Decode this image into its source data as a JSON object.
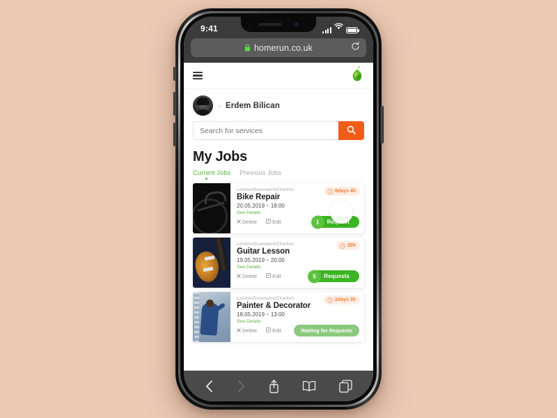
{
  "device": {
    "status_bar": {
      "time": "9:41",
      "signal_icon": "cellular-signal-icon",
      "wifi_icon": "wifi-icon",
      "battery_icon": "battery-icon"
    },
    "browser": {
      "lock_icon": "lock-icon",
      "url": "homerun.co.uk",
      "reload_icon": "reload-icon",
      "toolbar": [
        {
          "name": "back-button",
          "icon": "chevron-left-icon",
          "enabled": true
        },
        {
          "name": "forward-button",
          "icon": "chevron-right-icon",
          "enabled": false
        },
        {
          "name": "share-button",
          "icon": "share-icon",
          "enabled": true
        },
        {
          "name": "bookmarks-button",
          "icon": "book-icon",
          "enabled": true
        },
        {
          "name": "tabs-button",
          "icon": "tabs-icon",
          "enabled": true
        }
      ]
    }
  },
  "app": {
    "header": {
      "menu_icon": "hamburger-menu-icon",
      "logo_icon": "pear-logo-icon"
    },
    "profile": {
      "avatar_icon": "user-avatar",
      "separator": "·",
      "name": "Erdem Bilican"
    },
    "search": {
      "placeholder": "Search for services",
      "value": "",
      "button_icon": "search-icon"
    },
    "page_title": "My Jobs",
    "tabs": [
      {
        "label": "Current Jobs",
        "active": true
      },
      {
        "label": "Previous Jobs",
        "active": false
      }
    ],
    "jobs": [
      {
        "location": "London/Greenwich/Charlton",
        "title": "Bike Repair",
        "date": "20.05.2019",
        "separator": "•",
        "time": "18:00",
        "details_link": "See Details",
        "delete_label": "Delete",
        "delete_icon": "close-x-icon",
        "edit_label": "Edit",
        "edit_icon": "pencil-edit-icon",
        "time_badge": {
          "icon": "clock-icon",
          "text": "6days 4h"
        },
        "action": {
          "label": "Request",
          "count": "1",
          "style": "green",
          "has_badge": true
        },
        "thumbnail": "bike-photo"
      },
      {
        "location": "London/Greenwich/Charlton",
        "title": "Guitar Lesson",
        "date": "19.05.2019",
        "separator": "•",
        "time": "20:00",
        "details_link": "See Details",
        "delete_label": "Delete",
        "delete_icon": "close-x-icon",
        "edit_label": "Edit",
        "edit_icon": "pencil-edit-icon",
        "time_badge": {
          "icon": "clock-icon",
          "text": "20h"
        },
        "action": {
          "label": "Requests",
          "count": "5",
          "style": "green",
          "has_badge": true
        },
        "thumbnail": "guitar-photo"
      },
      {
        "location": "London/Greenwich/Charlton",
        "title": "Painter & Decorator",
        "date": "18.05.2019",
        "separator": "•",
        "time": "13:00",
        "details_link": "See Details",
        "delete_label": "Delete",
        "delete_icon": "close-x-icon",
        "edit_label": "Edit",
        "edit_icon": "pencil-edit-icon",
        "time_badge": {
          "icon": "clock-icon",
          "text": "2days 3h"
        },
        "action": {
          "label": "Waiting for Requests",
          "count": "",
          "style": "pale",
          "has_badge": false
        },
        "thumbnail": "painter-photo"
      }
    ]
  },
  "colors": {
    "background": "#eccab4",
    "accent_orange": "#f25c19",
    "accent_green": "#3cb522",
    "link_green": "#5cb340",
    "pale_green": "#8cc97e",
    "badge_bg": "#fdeee6",
    "badge_text": "#f07c2e",
    "chrome_gray": "#3b3b3b"
  }
}
